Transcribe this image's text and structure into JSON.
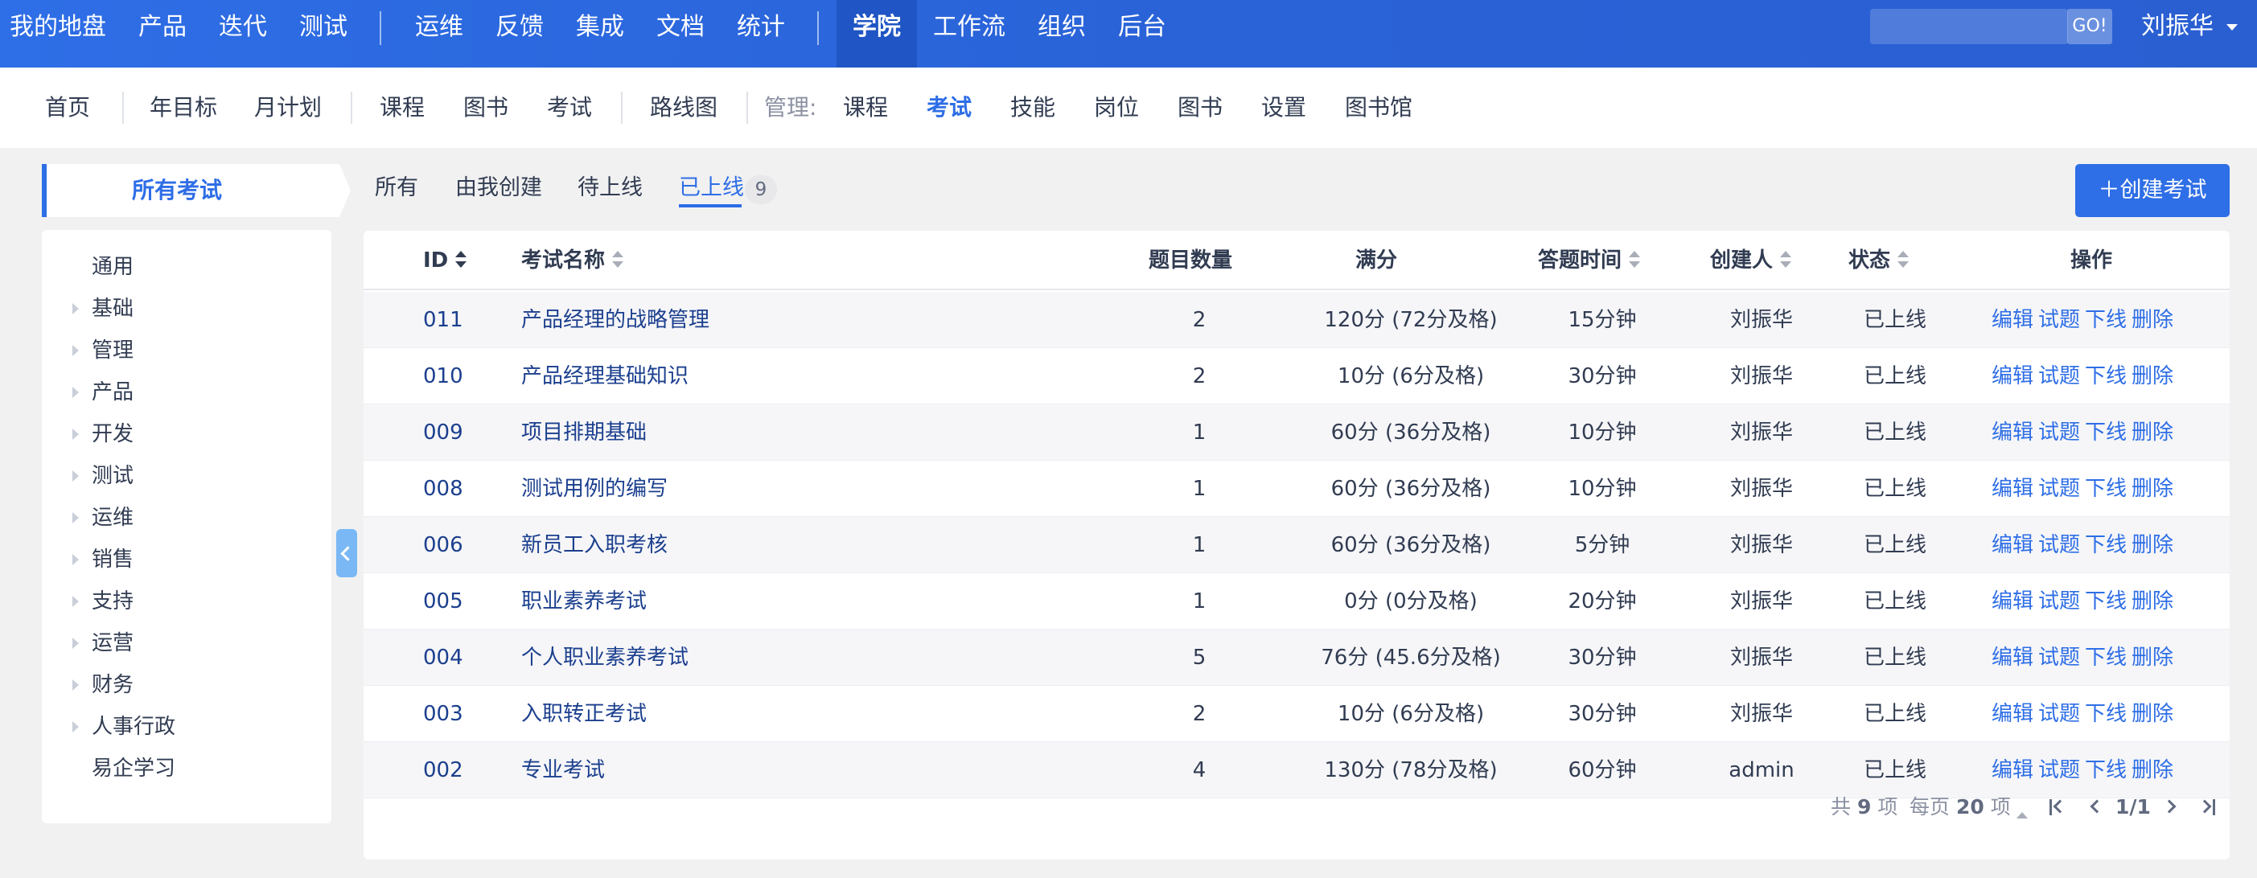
{
  "topnav": {
    "items": [
      "我的地盘",
      "产品",
      "迭代",
      "测试",
      "运维",
      "反馈",
      "集成",
      "文档",
      "统计",
      "学院",
      "工作流",
      "组织",
      "后台"
    ],
    "active": "学院",
    "search_button": "GO!",
    "user": "刘振华"
  },
  "subnav": {
    "items": [
      "首页",
      "年目标",
      "月计划",
      "课程",
      "图书",
      "考试",
      "路线图"
    ],
    "manage_label": "管理:",
    "manage_items": [
      "课程",
      "考试",
      "技能",
      "岗位",
      "图书",
      "设置",
      "图书馆"
    ],
    "active": "考试"
  },
  "section_title": "所有考试",
  "tree": [
    {
      "label": "通用",
      "expandable": false
    },
    {
      "label": "基础",
      "expandable": true
    },
    {
      "label": "管理",
      "expandable": true
    },
    {
      "label": "产品",
      "expandable": true
    },
    {
      "label": "开发",
      "expandable": true
    },
    {
      "label": "测试",
      "expandable": true
    },
    {
      "label": "运维",
      "expandable": true
    },
    {
      "label": "销售",
      "expandable": true
    },
    {
      "label": "支持",
      "expandable": true
    },
    {
      "label": "运营",
      "expandable": true
    },
    {
      "label": "财务",
      "expandable": true
    },
    {
      "label": "人事行政",
      "expandable": true
    },
    {
      "label": "易企学习",
      "expandable": false
    }
  ],
  "filter_tabs": [
    "所有",
    "由我创建",
    "待上线",
    "已上线"
  ],
  "active_filter": "已上线",
  "active_filter_count": "9",
  "create_button": "创建考试",
  "table": {
    "headers": {
      "id": "ID",
      "name": "考试名称",
      "count": "题目数量",
      "score": "满分",
      "time": "答题时间",
      "creator": "创建人",
      "status": "状态",
      "actions": "操作"
    },
    "actions": [
      "编辑",
      "试题",
      "下线",
      "删除"
    ],
    "rows": [
      {
        "id": "011",
        "name": "产品经理的战略管理",
        "count": "2",
        "score": "120分 (72分及格)",
        "time": "15分钟",
        "creator": "刘振华",
        "status": "已上线"
      },
      {
        "id": "010",
        "name": "产品经理基础知识",
        "count": "2",
        "score": "10分 (6分及格)",
        "time": "30分钟",
        "creator": "刘振华",
        "status": "已上线"
      },
      {
        "id": "009",
        "name": "项目排期基础",
        "count": "1",
        "score": "60分 (36分及格)",
        "time": "10分钟",
        "creator": "刘振华",
        "status": "已上线"
      },
      {
        "id": "008",
        "name": "测试用例的编写",
        "count": "1",
        "score": "60分 (36分及格)",
        "time": "10分钟",
        "creator": "刘振华",
        "status": "已上线"
      },
      {
        "id": "006",
        "name": "新员工入职考核",
        "count": "1",
        "score": "60分 (36分及格)",
        "time": "5分钟",
        "creator": "刘振华",
        "status": "已上线"
      },
      {
        "id": "005",
        "name": "职业素养考试",
        "count": "1",
        "score": "0分 (0分及格)",
        "time": "20分钟",
        "creator": "刘振华",
        "status": "已上线"
      },
      {
        "id": "004",
        "name": "个人职业素养考试",
        "count": "5",
        "score": "76分 (45.6分及格)",
        "time": "30分钟",
        "creator": "刘振华",
        "status": "已上线"
      },
      {
        "id": "003",
        "name": "入职转正考试",
        "count": "2",
        "score": "10分 (6分及格)",
        "time": "30分钟",
        "creator": "刘振华",
        "status": "已上线"
      },
      {
        "id": "002",
        "name": "专业考试",
        "count": "4",
        "score": "130分 (78分及格)",
        "time": "60分钟",
        "creator": "admin",
        "status": "已上线"
      }
    ]
  },
  "pager": {
    "total_prefix": "共",
    "total": "9",
    "total_suffix": "项",
    "per_page_prefix": "每页",
    "per_page": "20",
    "per_page_suffix": "项",
    "page": "1/1"
  }
}
